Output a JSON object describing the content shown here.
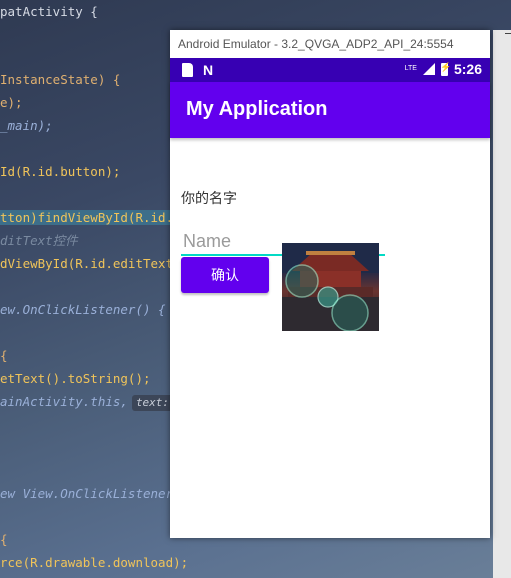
{
  "ide": {
    "lines": [
      {
        "t1": "patActivity {"
      },
      {
        "t1": "InstanceState) {"
      },
      {
        "t1": "e);"
      },
      {
        "t1": "_main);"
      },
      {
        "t1": "Id(R.id.button);"
      },
      {
        "t1": "tton)findViewById(R.id.im"
      },
      {
        "t1": "ditText控件"
      },
      {
        "t1": "dViewById(R.id.editTextTe"
      },
      {
        "t1": "ew.OnClickListener() {"
      },
      {
        "t1": "{"
      },
      {
        "t1": "etText().toString();"
      },
      {
        "t1": "ainActivity.this,",
        "tag": "text:",
        "t2": "\""
      },
      {
        "t1": "ew View.OnClickListener()"
      },
      {
        "t1": "{"
      },
      {
        "t1": "rce(R.drawable.download);"
      }
    ]
  },
  "emulator": {
    "window_title": "Android Emulator - 3.2_QVGA_ADP2_API_24:5554",
    "status_bar": {
      "network": "LTE",
      "time": "5:26",
      "color": "#3700b3"
    },
    "app_bar": {
      "title": "My Application",
      "color": "#6200ee"
    },
    "content": {
      "name_label": "你的名字",
      "name_input_placeholder": "Name",
      "name_input_value": "",
      "confirm_button_label": "确认",
      "accent_color": "#03dac5"
    }
  }
}
